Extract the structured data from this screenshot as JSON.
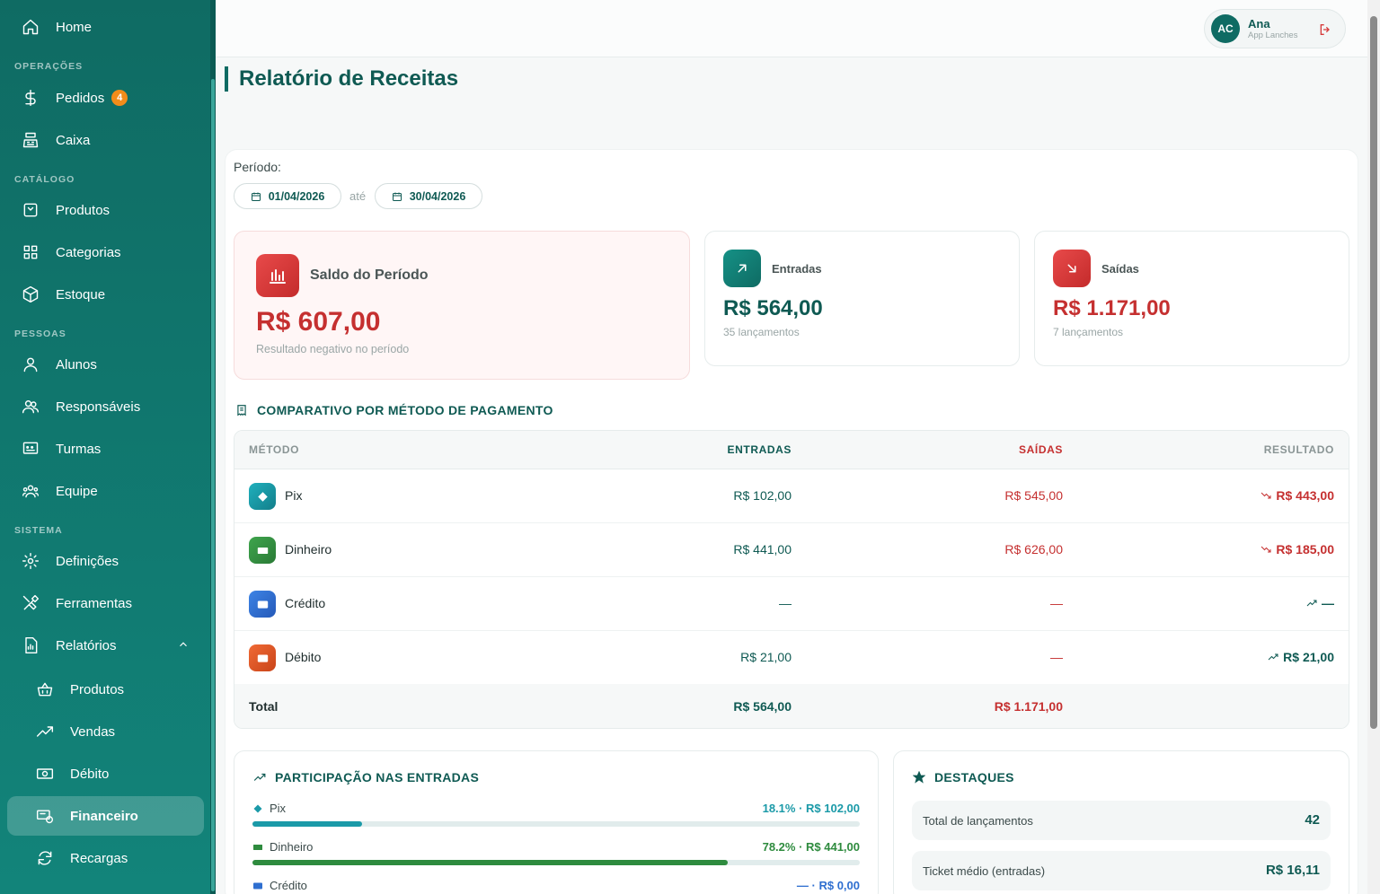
{
  "sidebar": {
    "home": "Home",
    "sections": {
      "operacoes": "OPERAÇÕES",
      "catalogo": "CATÁLOGO",
      "pessoas": "PESSOAS",
      "sistema": "SISTEMA"
    },
    "items": {
      "pedidos": "Pedidos",
      "pedidos_badge": "4",
      "caixa": "Caixa",
      "produtos": "Produtos",
      "categorias": "Categorias",
      "estoque": "Estoque",
      "alunos": "Alunos",
      "responsaveis": "Responsáveis",
      "turmas": "Turmas",
      "equipe": "Equipe",
      "definicoes": "Definições",
      "ferramentas": "Ferramentas",
      "relatorios": "Relatórios"
    },
    "sub_items": {
      "produtos": "Produtos",
      "vendas": "Vendas",
      "debito": "Débito",
      "financeiro": "Financeiro",
      "recargas": "Recargas"
    },
    "active": "financeiro"
  },
  "user": {
    "initials": "AC",
    "name": "Ana",
    "app": "App Lanches"
  },
  "page": {
    "title": "Relatório de Receitas"
  },
  "period": {
    "label": "Período:",
    "from": "01/04/2026",
    "separator": "até",
    "to": "30/04/2026"
  },
  "summary": {
    "saldo": {
      "title": "Saldo do Período",
      "value": "R$ 607,00",
      "note": "Resultado negativo no período"
    },
    "entradas": {
      "title": "Entradas",
      "value": "R$ 564,00",
      "note": "35 lançamentos"
    },
    "saidas": {
      "title": "Saídas",
      "value": "R$ 1.171,00",
      "note": "7 lançamentos"
    }
  },
  "comparativo": {
    "title": "COMPARATIVO POR MÉTODO DE PAGAMENTO",
    "headers": {
      "metodo": "MÉTODO",
      "entradas": "ENTRADAS",
      "saidas": "SAÍDAS",
      "resultado": "RESULTADO"
    },
    "rows": [
      {
        "method": "Pix",
        "in": "R$ 102,00",
        "out": "R$ 545,00",
        "result": "R$ 443,00",
        "trend": "down"
      },
      {
        "method": "Dinheiro",
        "in": "R$ 441,00",
        "out": "R$ 626,00",
        "result": "R$ 185,00",
        "trend": "down"
      },
      {
        "method": "Crédito",
        "in": "—",
        "out": "—",
        "result": "—",
        "trend": "up"
      },
      {
        "method": "Débito",
        "in": "R$ 21,00",
        "out": "—",
        "result": "R$ 21,00",
        "trend": "up"
      }
    ],
    "total": {
      "label": "Total",
      "in": "R$ 564,00",
      "out": "R$ 1.171,00"
    }
  },
  "participacao": {
    "title": "PARTICIPAÇÃO NAS ENTRADAS",
    "items": [
      {
        "method": "Pix",
        "value": "18.1% · R$ 102,00",
        "percent": 18.1
      },
      {
        "method": "Dinheiro",
        "value": "78.2% · R$ 441,00",
        "percent": 78.2
      },
      {
        "method": "Crédito",
        "value": "— · R$ 0,00",
        "percent": 0
      }
    ]
  },
  "destaques": {
    "title": "DESTAQUES",
    "items": [
      {
        "label": "Total de lançamentos",
        "value": "42"
      },
      {
        "label": "Ticket médio (entradas)",
        "value": "R$ 16,11"
      }
    ]
  },
  "colors": {
    "primary": "#0f6b63",
    "negative": "#c53030",
    "accent_badge": "#f28c1a",
    "pix": "#1b9aa8",
    "dinheiro": "#2e8b3e",
    "credito": "#2f6fd0",
    "debito": "#e0552a"
  }
}
